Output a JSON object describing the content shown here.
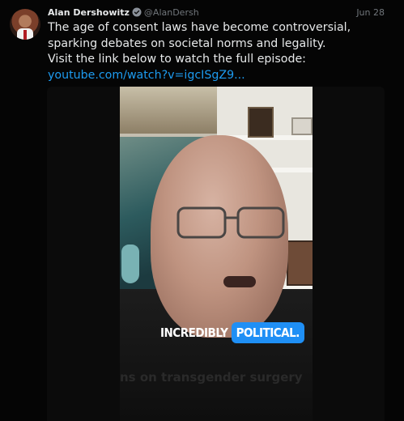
{
  "tweet": {
    "author_name": "Alan Dershowitz",
    "handle": "@AlanDersh",
    "date": "Jun 28",
    "text_line1": "The age of consent laws have become controversial, sparking debates on societal norms and legality.",
    "text_line2": "Visit the link below to watch the full episode:",
    "link": "youtube.com/watch?v=igcISgZ9..."
  },
  "media": {
    "caption_part1": "INCREDIBLY",
    "caption_part2": "POLITICAL.",
    "faded_subtitle": "ns on transgender surgery"
  },
  "icons": {
    "verified": "verified-badge-icon"
  },
  "colors": {
    "background": "#000000",
    "text": "#e7e9ea",
    "secondary": "#71767b",
    "link": "#1d9bf0",
    "caption_highlight": "#1f8ff5"
  }
}
